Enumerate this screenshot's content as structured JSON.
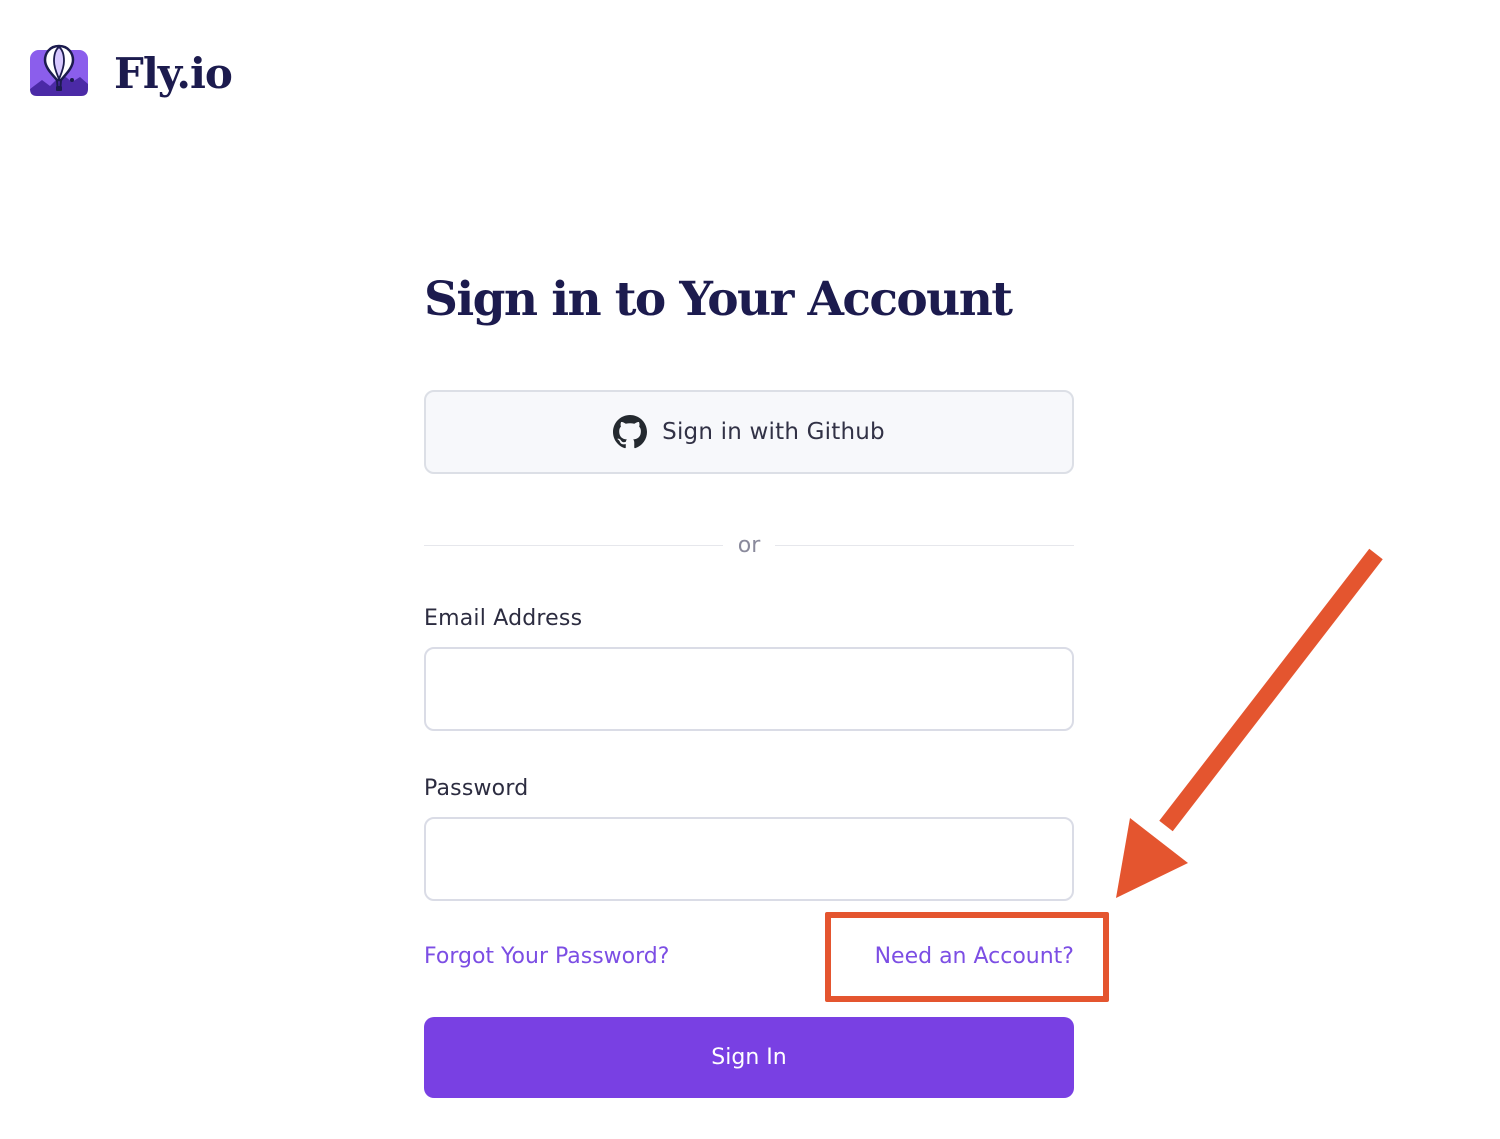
{
  "brand": {
    "name": "Fly.io",
    "logo_icon": "hot-air-balloon-logo-icon",
    "logo_color": "#7b4ae8"
  },
  "form": {
    "title": "Sign in to Your Account",
    "github_button": {
      "label": "Sign in with Github",
      "icon": "github-icon"
    },
    "divider_text": "or",
    "email": {
      "label": "Email Address",
      "value": "",
      "placeholder": ""
    },
    "password": {
      "label": "Password",
      "value": "",
      "placeholder": ""
    },
    "forgot_link": "Forgot Your Password?",
    "need_account_link": "Need an Account?",
    "submit_label": "Sign In"
  },
  "colors": {
    "primary": "#7940e3",
    "link": "#7c4ee4",
    "heading": "#1c1b4e",
    "annotation": "#e4552f"
  },
  "annotation": {
    "highlight_target": "need-account-link",
    "arrow_icon": "arrow-pointer-icon"
  }
}
